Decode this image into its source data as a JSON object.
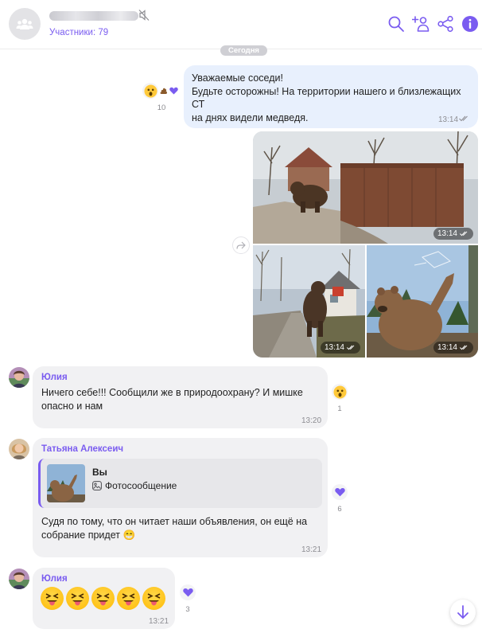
{
  "header": {
    "members_label": "Участники: 79",
    "icons": [
      "group-icon",
      "mute-icon",
      "search-icon",
      "add-member-icon",
      "share-icon",
      "info-icon"
    ]
  },
  "date_divider": "Сегодня",
  "colors": {
    "accent": "#7a5cf0",
    "outgoing_bubble": "#e8f0fd",
    "incoming_bubble": "#f1f1f3"
  },
  "messages": [
    {
      "direction": "outgoing",
      "text": "Уважаемые соседи!\nБудьте осторожны! На территории нашего и близлежащих СТ\nна днях видели медведя.",
      "time": "13:14",
      "reaction_count": "10"
    },
    {
      "direction": "outgoing",
      "type": "photos",
      "photo_times": [
        "13:14",
        "13:14",
        "13:14"
      ]
    },
    {
      "direction": "incoming",
      "sender": "Юлия",
      "text": "Ничего себе!!! Сообщили же в природоохрану? И мишке\nопасно и нам",
      "time": "13:20",
      "reaction_count": "1"
    },
    {
      "direction": "incoming",
      "sender": "Татьяна Алексеич",
      "quote": {
        "author": "Вы",
        "text": "Фотосообщение"
      },
      "text": "Судя по тому, что он читает наши объявления, он ещё на\nсобрание придет 😁",
      "time": "13:21",
      "reaction_count": "6"
    },
    {
      "direction": "incoming",
      "sender": "Юлия",
      "emoji_count": 5,
      "time": "13:21",
      "reaction_count": "3"
    }
  ]
}
